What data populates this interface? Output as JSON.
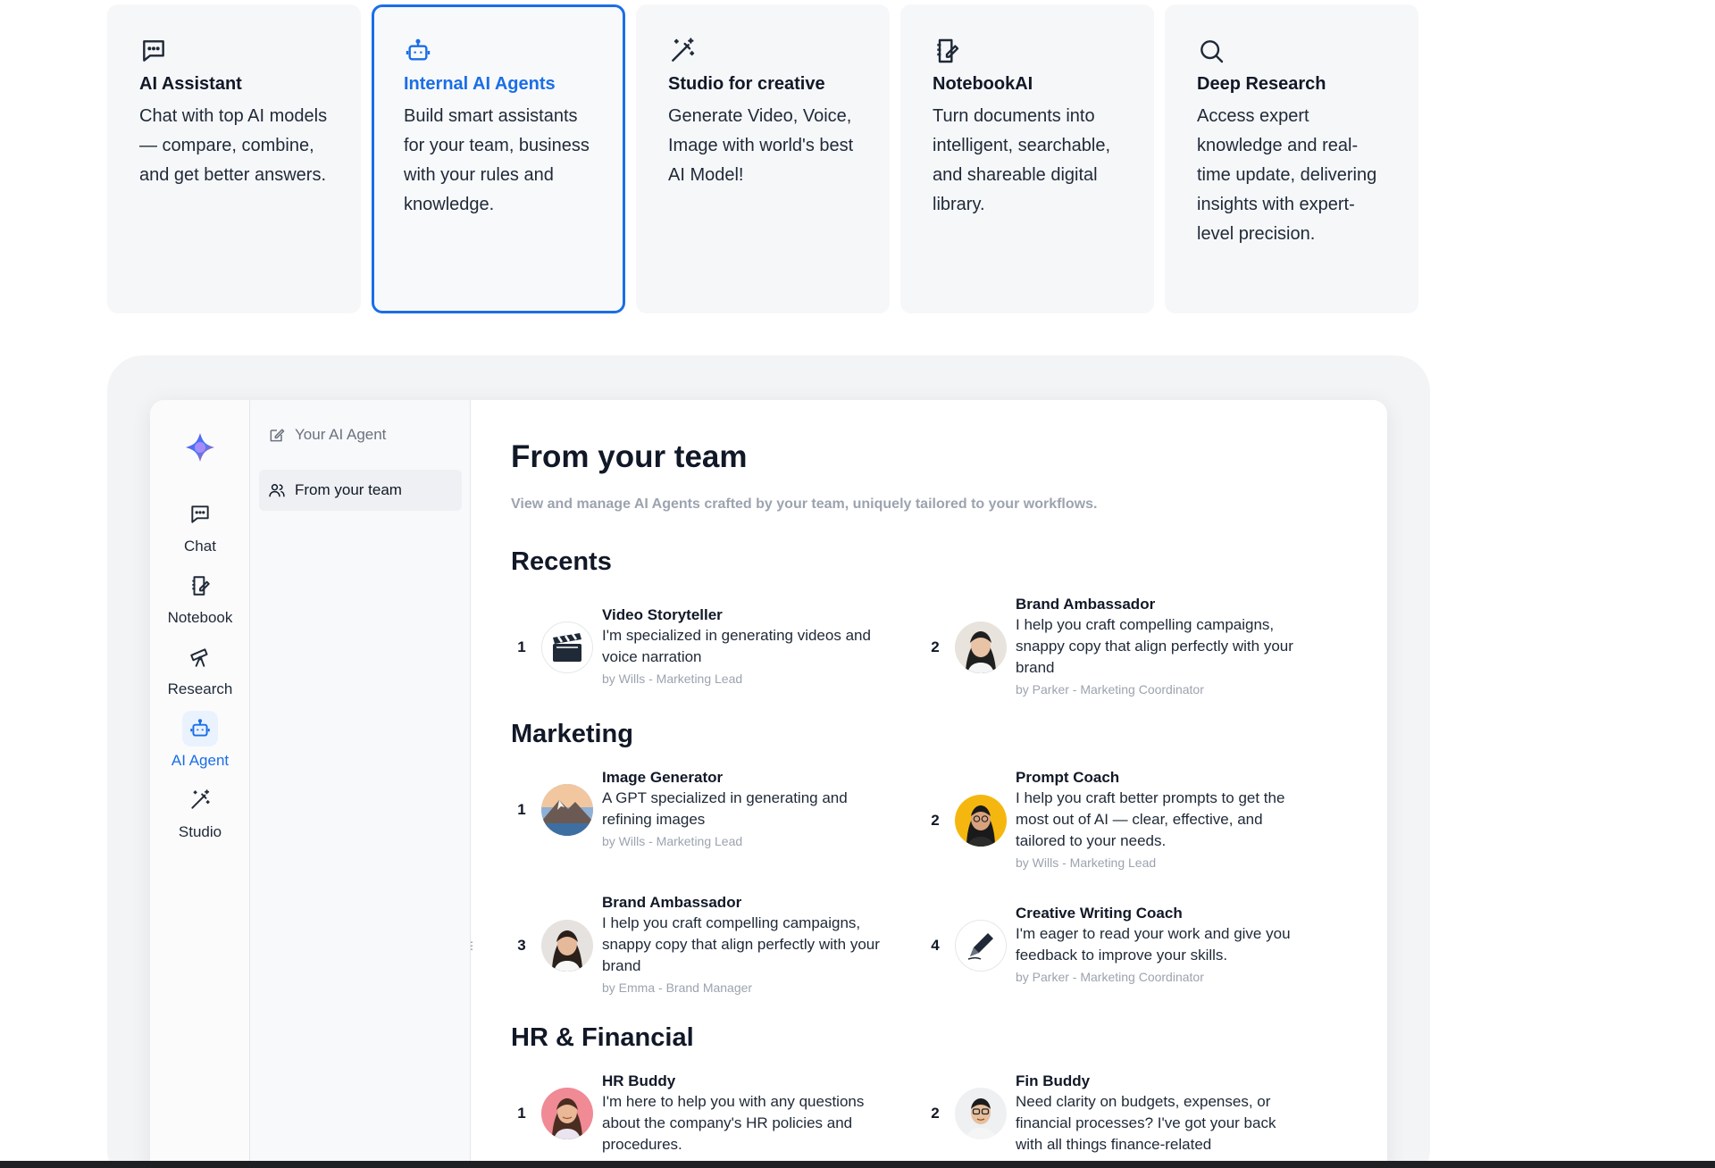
{
  "cards": [
    {
      "icon": "chat-icon",
      "title": "AI Assistant",
      "desc": "Chat with top AI models — compare, combine, and get better answers.",
      "active": false
    },
    {
      "icon": "robot-icon",
      "title": "Internal AI Agents",
      "desc": "Build smart assistants for your team, business with your rules and knowledge.",
      "active": true
    },
    {
      "icon": "magic-wand-icon",
      "title": "Studio for creative",
      "desc": "Generate Video, Voice, Image with world's best AI Model!",
      "active": false
    },
    {
      "icon": "notebook-icon",
      "title": "NotebookAI",
      "desc": "Turn documents into intelligent, searchable, and shareable digital library.",
      "active": false
    },
    {
      "icon": "search-icon",
      "title": "Deep Research",
      "desc": "Access expert knowledge and real-time update, delivering insights with expert-level precision.",
      "active": false
    }
  ],
  "rail": {
    "items": [
      {
        "icon": "chat-icon",
        "label": "Chat"
      },
      {
        "icon": "notebook-icon",
        "label": "Notebook"
      },
      {
        "icon": "telescope-icon",
        "label": "Research"
      },
      {
        "icon": "robot-icon",
        "label": "AI Agent"
      },
      {
        "icon": "magic-wand-icon",
        "label": "Studio"
      }
    ]
  },
  "side": {
    "your_agent": "Your AI Agent",
    "from_team": "From your team"
  },
  "main": {
    "title": "From your team",
    "subtitle": "View and manage AI Agents crafted by your team, uniquely tailored to your workflows."
  },
  "sections": {
    "recents": {
      "title": "Recents",
      "agents": [
        {
          "num": "1",
          "name": "Video Storyteller",
          "desc": "I'm specialized in generating videos and voice narration",
          "by": "by Wills - Marketing Lead",
          "avatar": "clapperboard-icon"
        },
        {
          "num": "2",
          "name": "Brand Ambassador",
          "desc": "I help you craft compelling campaigns, snappy copy that align perfectly with your brand",
          "by": "by Parker - Marketing Coordinator",
          "avatar": "person-avatar"
        }
      ]
    },
    "marketing": {
      "title": "Marketing",
      "agents": [
        {
          "num": "1",
          "name": "Image Generator",
          "desc": "A GPT specialized in generating and refining images",
          "by": "by Wills - Marketing Lead",
          "avatar": "mountain-avatar"
        },
        {
          "num": "2",
          "name": "Prompt Coach",
          "desc": "I help you craft better prompts to get the most out of AI — clear, effective, and tailored to your needs.",
          "by": "by Wills - Marketing Lead",
          "avatar": "person-avatar"
        },
        {
          "num": "3",
          "name": "Brand Ambassador",
          "desc": "I help you craft compelling campaigns, snappy copy that align perfectly with your brand",
          "by": "by Emma - Brand Manager",
          "avatar": "person-avatar"
        },
        {
          "num": "4",
          "name": "Creative Writing Coach",
          "desc": "I'm eager to read your work and give you feedback to improve your skills.",
          "by": "by Parker - Marketing Coordinator",
          "avatar": "pen-icon"
        }
      ]
    },
    "hr": {
      "title": "HR & Financial",
      "agents": [
        {
          "num": "1",
          "name": "HR Buddy",
          "desc": "I'm here to help you with any questions about the company's HR policies and procedures.",
          "by": "",
          "avatar": "person-avatar"
        },
        {
          "num": "2",
          "name": "Fin Buddy",
          "desc": "Need clarity on budgets, expenses, or financial processes? I've got your back with all things finance-related",
          "by": "",
          "avatar": "person-avatar"
        }
      ]
    }
  },
  "colors": {
    "accent": "#1a6ee6",
    "muted_text": "#9ca3af",
    "frame_bg": "#f3f4f6"
  }
}
